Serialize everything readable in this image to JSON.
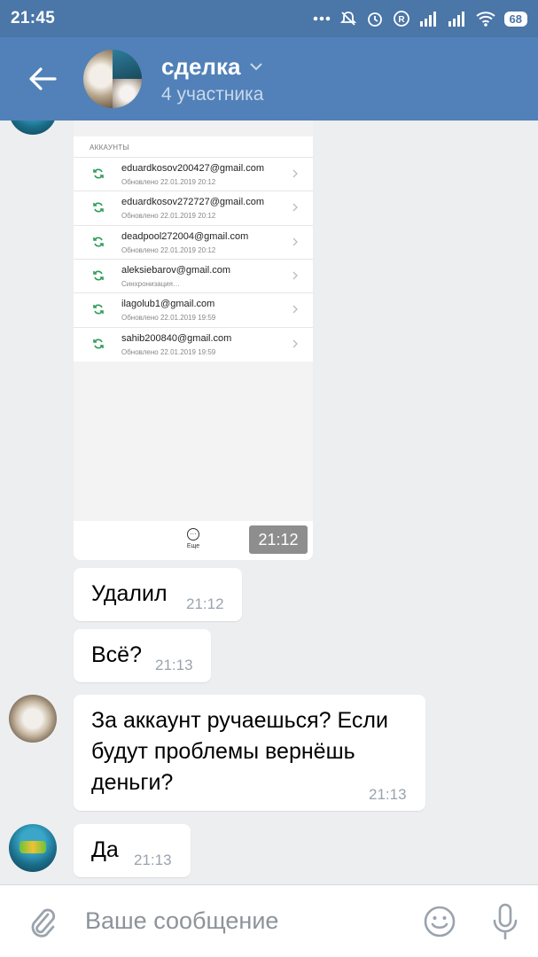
{
  "status_bar": {
    "time": "21:45",
    "battery": "68",
    "icons": [
      "dots-icon",
      "muted-bell-icon",
      "alarm-icon",
      "registered-icon",
      "signal-icon",
      "signal-icon",
      "wifi-icon",
      "battery-icon"
    ]
  },
  "header": {
    "title": "сделка",
    "subtitle": "4 участника"
  },
  "screenshot": {
    "accounts_label": "АККАУНТЫ",
    "accounts": [
      {
        "email": "eduardkosov200427@gmail.com",
        "status": "Обновлено 22.01.2019 20:12"
      },
      {
        "email": "eduardkosov272727@gmail.com",
        "status": "Обновлено 22.01.2019 20:12"
      },
      {
        "email": "deadpool272004@gmail.com",
        "status": "Обновлено 22.01.2019 20:12"
      },
      {
        "email": "aleksiebarov@gmail.com",
        "status": "Синхронизация…"
      },
      {
        "email": "ilagolub1@gmail.com",
        "status": "Обновлено 22.01.2019 19:59"
      },
      {
        "email": "sahib200840@gmail.com",
        "status": "Обновлено 22.01.2019 19:59"
      }
    ],
    "more_label": "Еще",
    "time": "21:12"
  },
  "messages": [
    {
      "text": "Удалил",
      "time": "21:12"
    },
    {
      "text": "Всё?",
      "time": "21:13"
    },
    {
      "text": "За аккаунт ручаешься? Если будут проблемы вернёшь деньги?",
      "time": "21:13"
    },
    {
      "text": "Да",
      "time": "21:13"
    }
  ],
  "composer": {
    "placeholder": "Ваше сообщение"
  },
  "colors": {
    "status_bar": "#4a76a8",
    "header": "#5181b8",
    "background": "#edeef0"
  }
}
